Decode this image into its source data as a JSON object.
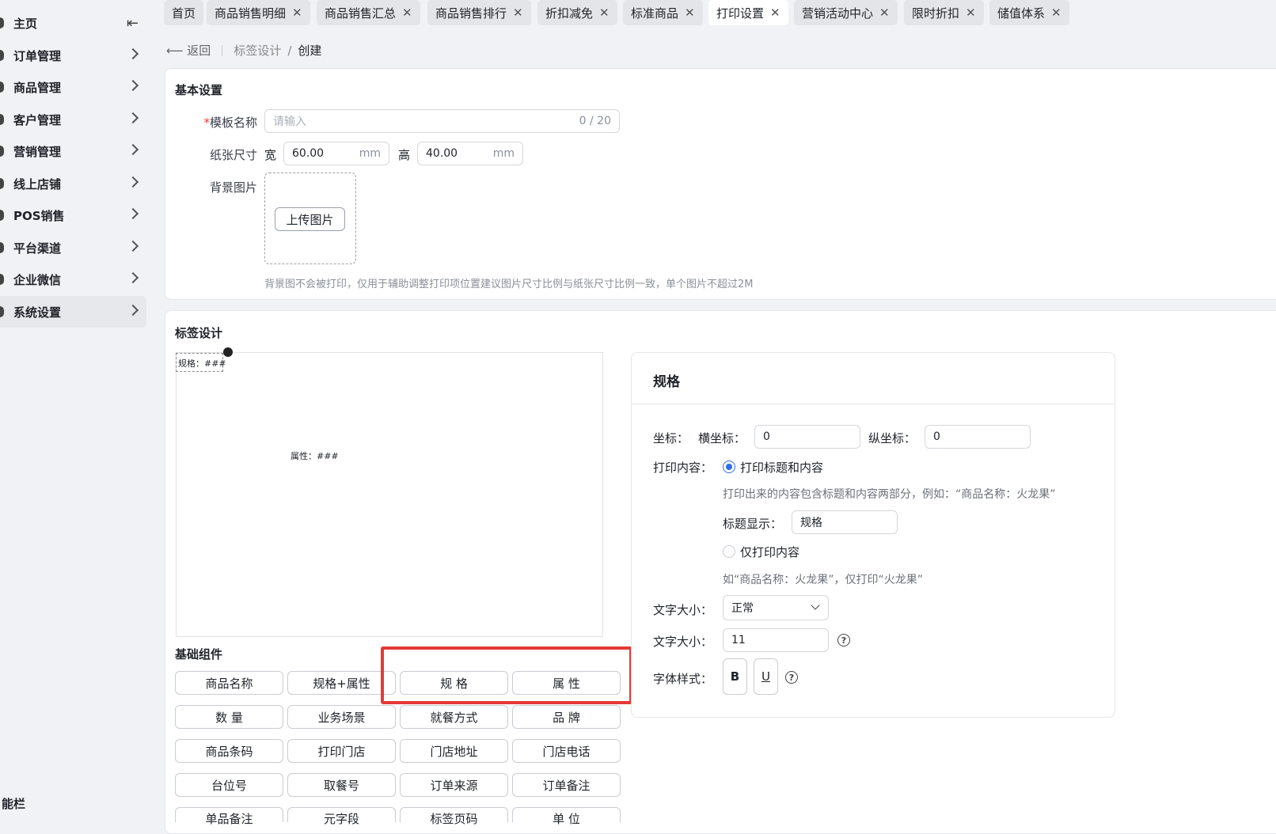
{
  "sidebar": {
    "items": [
      {
        "label": "主页"
      },
      {
        "label": "订单管理"
      },
      {
        "label": "商品管理"
      },
      {
        "label": "客户管理"
      },
      {
        "label": "营销管理"
      },
      {
        "label": "线上店铺"
      },
      {
        "label": "POS销售"
      },
      {
        "label": "平台渠道"
      },
      {
        "label": "企业微信"
      },
      {
        "label": "系统设置"
      }
    ],
    "collapse_icon": "collapse-left-icon",
    "footer": "能栏"
  },
  "tabs": [
    {
      "label": "首页"
    },
    {
      "label": "商品销售明细"
    },
    {
      "label": "商品销售汇总"
    },
    {
      "label": "商品销售排行"
    },
    {
      "label": "折扣减免"
    },
    {
      "label": "标准商品"
    },
    {
      "label": "打印设置"
    },
    {
      "label": "营销活动中心"
    },
    {
      "label": "限时折扣"
    },
    {
      "label": "储值体系"
    }
  ],
  "breadcrumb": {
    "back": "返回",
    "parent": "标签设计",
    "sep": "/",
    "current": "创建"
  },
  "basic": {
    "title": "基本设置",
    "name_label": "模板名称",
    "name_placeholder": "请输入",
    "name_counter": "0 / 20",
    "size_label": "纸张尺寸",
    "width_label": "宽",
    "width_value": "60.00",
    "height_label": "高",
    "height_value": "40.00",
    "unit": "mm",
    "bg_label": "背景图片",
    "upload_label": "上传图片",
    "hint": "背景图不会被打印，仅用于辅助调整打印项位置建议图片尺寸比例与纸张尺寸比例一致，单个图片不超过2M"
  },
  "design": {
    "title": "标签设计",
    "canvas_items": [
      "规格：###",
      "属性：###"
    ],
    "components_title": "基础组件",
    "components": [
      "商品名称",
      "规格+属性",
      "规 格",
      "属 性",
      "数 量",
      "业务场景",
      "就餐方式",
      "品 牌",
      "商品条码",
      "打印门店",
      "门店地址",
      "门店电话",
      "台位号",
      "取餐号",
      "订单来源",
      "订单备注",
      "单品备注",
      "元字段",
      "标签页码",
      "单 位"
    ]
  },
  "props": {
    "title": "规格",
    "coord_label": "坐标：",
    "x_label": "横坐标：",
    "x_value": "0",
    "y_label": "纵坐标：",
    "y_value": "0",
    "content_label": "打印内容：",
    "opt1": "打印标题和内容",
    "opt1_note": "打印出来的内容包含标题和内容两部分，例如：“商品名称：火龙果”",
    "title_display_label": "标题显示：",
    "title_display_value": "规格",
    "opt2": "仅打印内容",
    "opt2_note": "如“商品名称：火龙果”，仅打印“火龙果”",
    "size_label": "文字大小：",
    "size_value": "正常",
    "size2_label": "文字大小：",
    "size2_value": "11",
    "style_label": "字体样式：",
    "bold": "B",
    "underline": "U",
    "help": "?"
  }
}
